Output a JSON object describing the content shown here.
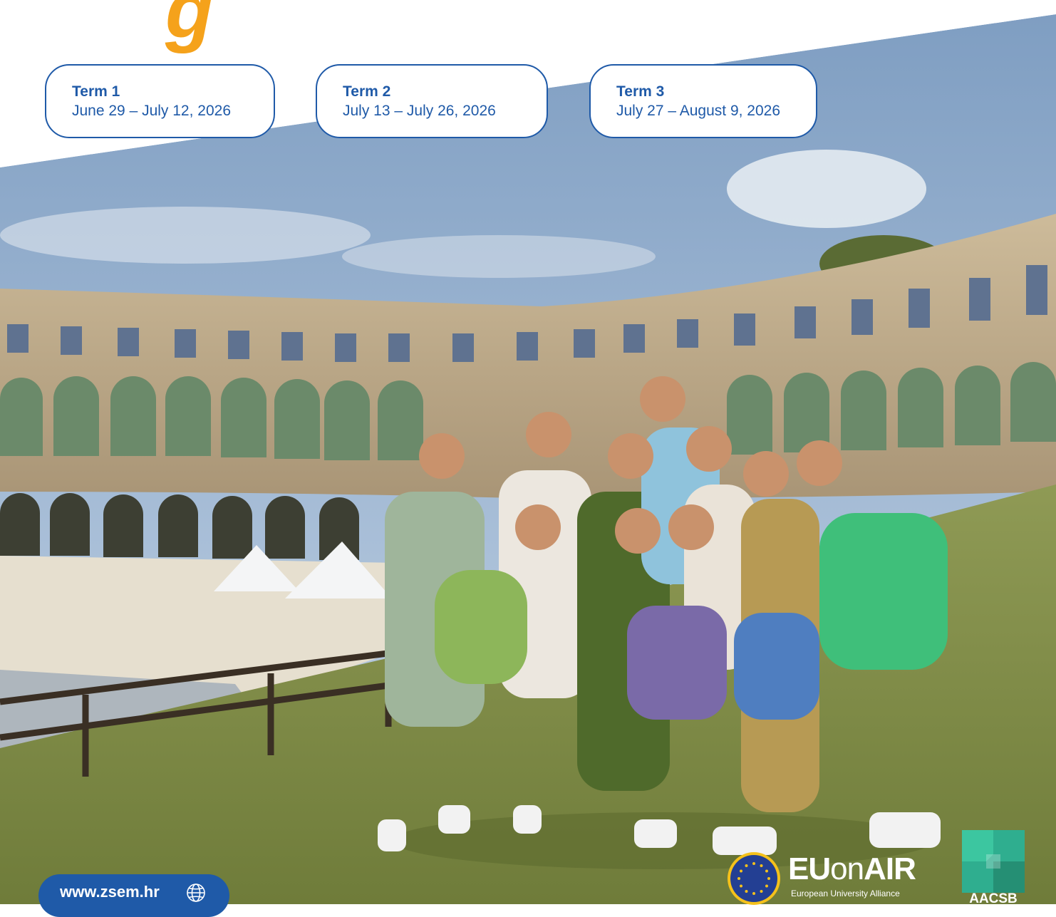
{
  "headline_fragment": "g",
  "terms": [
    {
      "title": "Term 1",
      "dates": "June 29 – July 12, 2026"
    },
    {
      "title": "Term 2",
      "dates": "July 13 – July 26, 2026"
    },
    {
      "title": "Term 3",
      "dates": "July 27 – August 9, 2026"
    }
  ],
  "website": {
    "label": "www.zsem.hr",
    "icon": "globe-icon"
  },
  "partners": {
    "euonair": {
      "name_eu": "EU",
      "name_on": "on",
      "name_air": "AIR",
      "tagline": "European University Alliance"
    },
    "aacsb": {
      "name": "AACSB"
    }
  },
  "colors": {
    "brand_blue": "#1f5aa8",
    "accent_orange": "#f5a21b",
    "aacsb_green": "#2fae8f"
  }
}
